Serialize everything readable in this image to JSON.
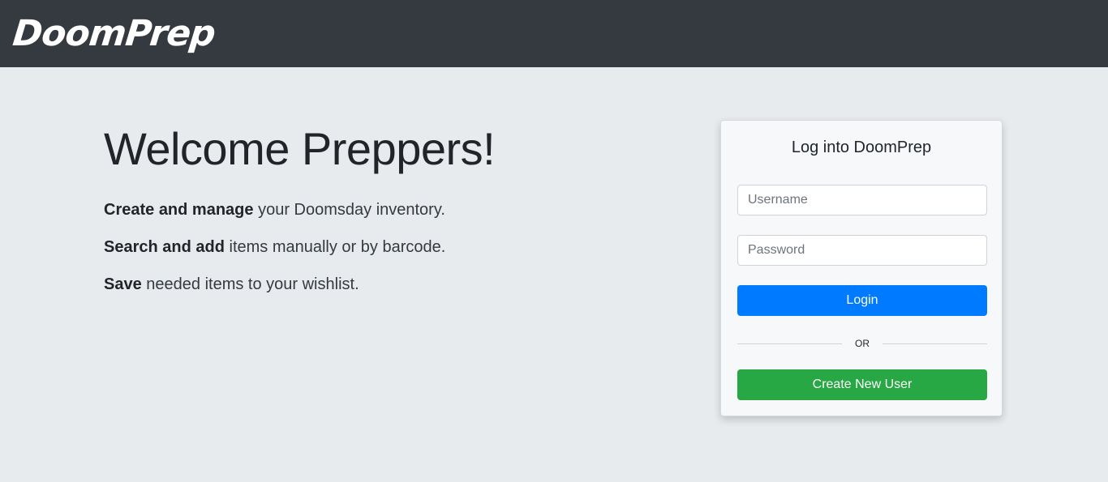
{
  "brand": {
    "logo_text": "DoomPrep"
  },
  "hero": {
    "title": "Welcome Preppers!",
    "features": [
      {
        "bold": "Create and manage",
        "rest": " your Doomsday inventory."
      },
      {
        "bold": "Search and add",
        "rest": " items manually or by barcode."
      },
      {
        "bold": "Save",
        "rest": " needed items to your wishlist."
      }
    ]
  },
  "login": {
    "title": "Log into DoomPrep",
    "username_placeholder": "Username",
    "password_placeholder": "Password",
    "login_label": "Login",
    "divider_text": "OR",
    "create_label": "Create New User"
  },
  "colors": {
    "navbar": "#343a40",
    "background": "#e8ebee",
    "primary": "#007bff",
    "success": "#28a745"
  }
}
